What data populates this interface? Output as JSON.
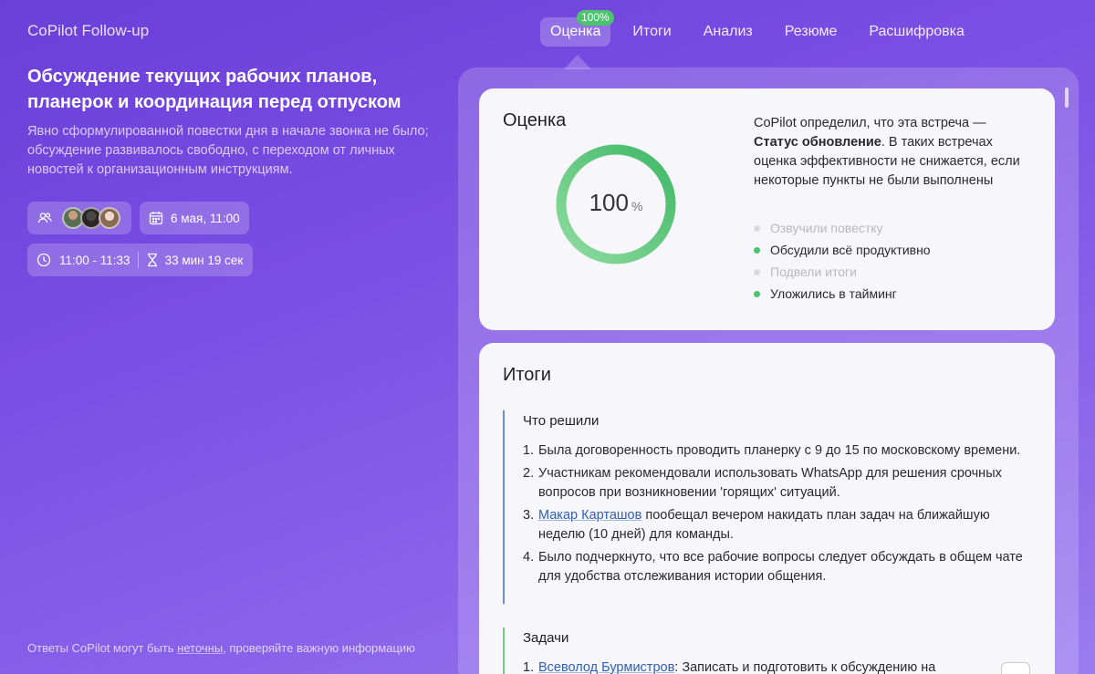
{
  "app": {
    "title": "CoPilot Follow-up"
  },
  "nav": {
    "tabs": [
      {
        "label": "Оценка",
        "active": true,
        "badge": "100%"
      },
      {
        "label": "Итоги"
      },
      {
        "label": "Анализ"
      },
      {
        "label": "Резюме"
      },
      {
        "label": "Расшифровка"
      }
    ]
  },
  "meeting": {
    "title": "Обсуждение текущих рабочих планов, планерок и координация перед отпуском",
    "description": "Явно сформулированной повестки дня в начале звонка не было; обсуждение развивалось свободно, с переходом от личных новостей к организационным инструкциям.",
    "date": "6 мая, 11:00",
    "time_range": "11:00 - 11:33",
    "duration": "33 мин 19 сек",
    "participants_icon": "people-icon",
    "date_icon": "calendar-icon",
    "time_icon": "clock-icon",
    "duration_icon": "hourglass-icon"
  },
  "footer": {
    "note_prefix": "Ответы CoPilot могут быть ",
    "note_link": "неточны",
    "note_suffix": ", проверяйте важную информацию"
  },
  "score_card": {
    "title": "Оценка",
    "score_value": "100",
    "score_unit": "%",
    "score_fraction": 1.0,
    "ring_color": "#4cc46e",
    "text_prefix": "CoPilot определил, что эта встреча —",
    "text_bold": "Статус обновление",
    "text_suffix": ". В таких встречах оценка эффективности не снижается, если некоторые пункты не были выполнены",
    "checklist": [
      {
        "label": "Озвучили повестку",
        "done": false
      },
      {
        "label": "Обсудили всё продуктивно",
        "done": true
      },
      {
        "label": "Подвели итоги",
        "done": false
      },
      {
        "label": "Уложились в тайминг",
        "done": true
      }
    ]
  },
  "summary_card": {
    "title": "Итоги",
    "decided": {
      "title": "Что решили",
      "items": [
        {
          "num": "1.",
          "text": "Была договоренность проводить планерку с 9 до 15 по московскому времени."
        },
        {
          "num": "2.",
          "text": "Участникам рекомендовали использовать WhatsApp для решения срочных вопросов при возникновении 'горящих' ситуаций."
        },
        {
          "num": "3.",
          "link": "Макар Карташов",
          "text": " пообещал вечером накидать план задач на ближайшую неделю (10 дней) для команды."
        },
        {
          "num": "4.",
          "text": "Было подчеркнуто, что все рабочие вопросы следует обсуждать в общем чате для удобства отслеживания истории общения."
        }
      ]
    },
    "tasks": {
      "title": "Задачи",
      "items": [
        {
          "num": "1.",
          "link": "Всеволод Бурмистров",
          "text": ": Записать и подготовить к обсуждению на"
        }
      ]
    }
  }
}
